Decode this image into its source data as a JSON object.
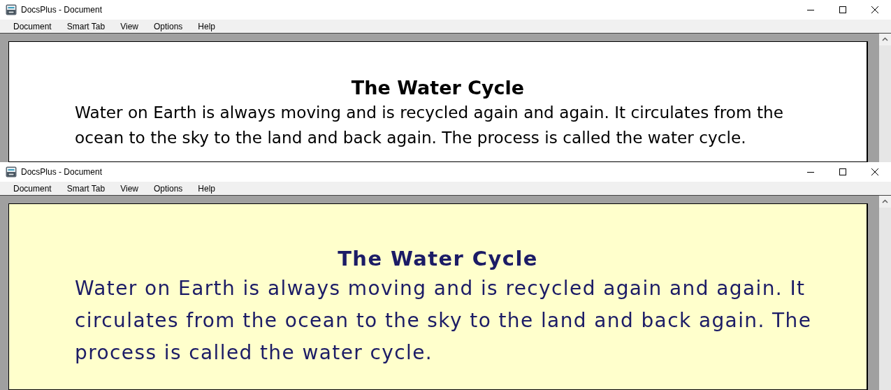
{
  "windows": [
    {
      "kind": "standard",
      "title": "DocsPlus - Document",
      "menu": [
        "Document",
        "Smart Tab",
        "View",
        "Options",
        "Help"
      ],
      "document": {
        "heading": "The Water Cycle",
        "paragraph": "Water on Earth is always moving and is recycled again and again. It circulates from the ocean to the sky to the land and back again. The process is called the water cycle."
      }
    },
    {
      "kind": "tinted",
      "title": "DocsPlus - Document",
      "menu": [
        "Document",
        "Smart Tab",
        "View",
        "Options",
        "Help"
      ],
      "document": {
        "heading": "The Water Cycle",
        "paragraph": "Water on Earth is always moving and is recycled again and again. It circulates from the ocean to the sky to the land and back again. The process is called the water cycle."
      }
    }
  ]
}
